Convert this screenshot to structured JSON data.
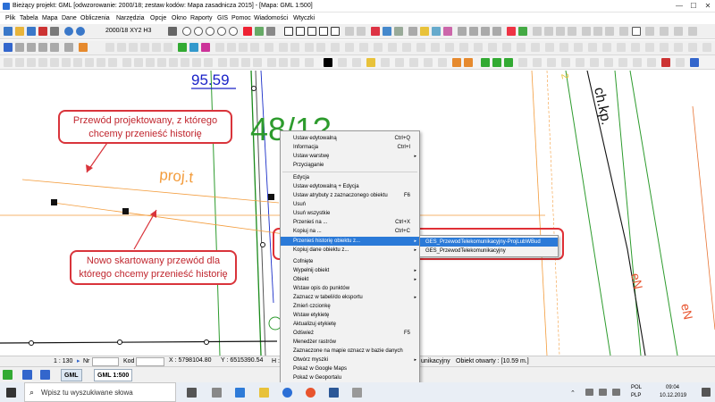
{
  "window": {
    "title": "Bieżący projekt: GML [odwzorowanie: 2000/18; zestaw kodów: Mapa zasadnicza 2015] - [Mapa: GML 1:500]",
    "minimize": "—",
    "maximize": "☐",
    "close": "✕"
  },
  "menu": [
    "Plik",
    "Tabela",
    "Mapa",
    "Dane",
    "Obliczenia",
    "Narzędzia",
    "Opcje",
    "Okno",
    "Raporty",
    "GIS",
    "Pomoc",
    "Wiadomości",
    "Wtyczki"
  ],
  "toolbar": {
    "coord_system": "2000/18 XY2 H3"
  },
  "map": {
    "labels": {
      "number_top": "95.59",
      "parcel": "48/1?",
      "proj_label": "proj.t",
      "ch_label": "ch.kp.",
      "en_1": "eN",
      "en_2": "eN",
      "number_2": "2"
    }
  },
  "callouts": {
    "top": [
      "Przewód projektowany, z którego",
      "chcemy przenieść historię"
    ],
    "bottom": [
      "Nowo skartowany przewód dla",
      "którego chcemy przenieść historię"
    ]
  },
  "context_menu": {
    "items": [
      {
        "label": "Ustaw edytowalną",
        "shortcut": "Ctrl+Q"
      },
      {
        "label": "Informacja",
        "shortcut": "Ctrl+I"
      },
      {
        "label": "Ustaw warstwę",
        "submenu": "▸"
      },
      {
        "label": "Przyciąganie"
      },
      {
        "label": "Edycja"
      },
      {
        "label": "Ustaw edytowalną + Edycja"
      },
      {
        "label": "Ustaw atrybuty z zaznaczonego obiektu",
        "shortcut": "F6"
      },
      {
        "label": "Usuń"
      },
      {
        "label": "Usuń wszystkie"
      },
      {
        "label": "Przenieś na ...",
        "shortcut": "Ctrl+X"
      },
      {
        "label": "Kopiuj na ...",
        "shortcut": "Ctrl+C"
      },
      {
        "label": "Przenieś historię obiektu z...",
        "submenu": "▸"
      },
      {
        "label": "Kopiuj dane obiektu z...",
        "submenu": "▸"
      },
      {
        "label": "Cofnięte"
      },
      {
        "label": "Wypełnij obiekt",
        "submenu": "▸"
      },
      {
        "label": "Obiekt",
        "submenu": "▸"
      },
      {
        "label": "Wstaw opis do punktów"
      },
      {
        "label": "Zaznacz w tabeli/do eksportu",
        "submenu": "▸"
      },
      {
        "label": "Zmień czcionkę"
      },
      {
        "label": "Wstaw etykietę"
      },
      {
        "label": "Aktualizuj etykietę"
      },
      {
        "label": "Odśwież",
        "shortcut": "F5"
      },
      {
        "label": "Menedżer rastrów"
      },
      {
        "label": "Zaznaczone na mapie oznacz w bazie danych"
      },
      {
        "label": "Otwórz myszki",
        "submenu": "▸"
      },
      {
        "label": "Pokaż w Google Maps"
      },
      {
        "label": "Pokaż w Geoportalu"
      }
    ],
    "highlighted_index": 11
  },
  "submenu": {
    "items": [
      {
        "label": "GES_PrzewodTelekomunikacyjny-ProjLubWBud"
      },
      {
        "label": "GES_PrzewodTelekomunikacyjny"
      }
    ],
    "highlighted_index": 0
  },
  "status": {
    "scale": "1 : 130",
    "nr_label": "Nr",
    "nr_value": "",
    "kod_label": "Kod",
    "kod_value": "",
    "x": "X : 5798104.80",
    "y": "Y : 6515390.54",
    "h": "H :",
    "layer_text": "unikacyjny",
    "object_text": "Obiekt otwarty : [10.59 m.]"
  },
  "layerbar": {
    "gml_tab": "GML",
    "gml_scale_tab": "GML 1:500"
  },
  "taskbar": {
    "search_placeholder": "Wpisz tu wyszukiwane słowa",
    "lang_top": "POL",
    "lang_bottom": "PLP",
    "time": "09:04",
    "date": "10.12.2019"
  },
  "colors": {
    "accent_highlight": "#2b7ad8",
    "callout_red": "#d9343b",
    "orange_line": "#f39c3c",
    "green_line": "#2d9b2d",
    "blue_text": "#1a22c8"
  }
}
